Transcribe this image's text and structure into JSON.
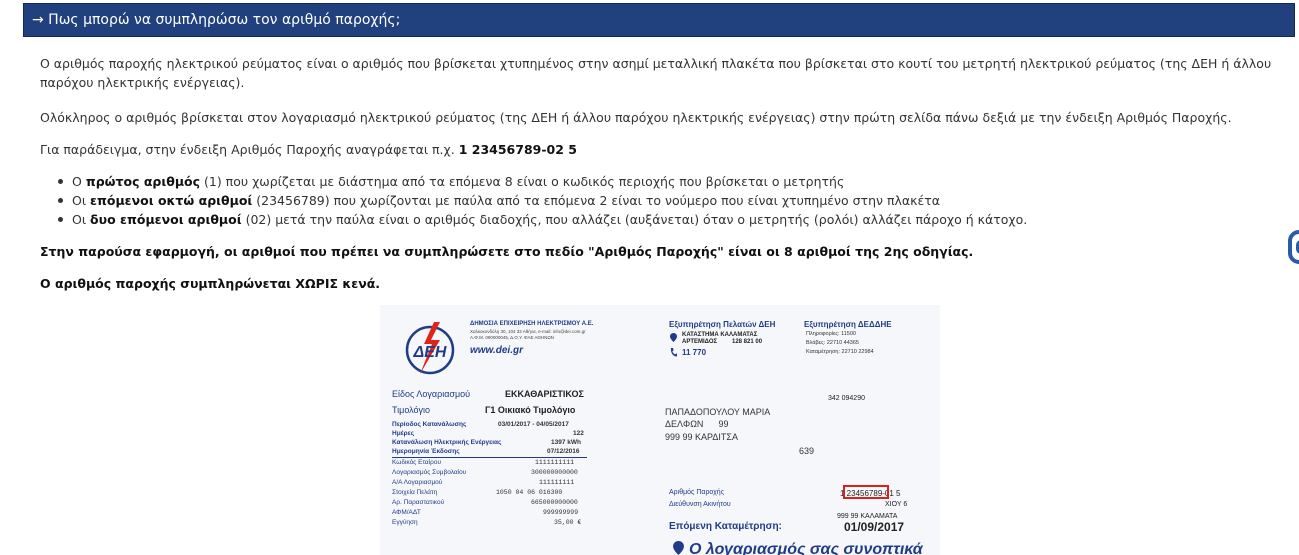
{
  "header": {
    "title": "→ Πως μπορώ να συμπληρώσω τον αριθμό παροχής;"
  },
  "paragraphs": {
    "p1": "Ο αριθμός παροχής ηλεκτρικού ρεύματος είναι ο αριθμός που βρίσκεται χτυπημένος στην ασημί μεταλλική πλακέτα που βρίσκεται στο κουτί του μετρητή ηλεκτρικού ρεύματος (της ΔΕΗ ή άλλου παρόχου ηλεκτρικής ενέργειας).",
    "p2": "Ολόκληρος ο αριθμός βρίσκεται στον λογαριασμό ηλεκτρικού ρεύματος (της ΔΕΗ ή άλλου παρόχου ηλεκτρικής ενέργειας) στην πρώτη σελίδα πάνω δεξιά με την ένδειξη Αριθμός Παροχής.",
    "p3_prefix": "Για παράδειγμα, στην ένδειξη Αριθμός Παροχής αναγράφεται π.χ. ",
    "p3_example": "1 23456789-02 5",
    "p4": "Στην παρούσα εφαρμογή, οι αριθμοί που πρέπει να συμπληρώσετε στο πεδίο \"Αριθμός Παροχής\" είναι οι 8 αριθμοί της 2ης οδηγίας.",
    "p5": "Ο αριθμός παροχής συμπληρώνεται ΧΩΡΙΣ κενά."
  },
  "bullets": [
    {
      "pre": "Ο ",
      "bold": "πρώτος αριθμός",
      "post": " (1) που χωρίζεται με διάστημα από τα επόμενα 8 είναι ο κωδικός περιοχής που βρίσκεται ο μετρητής"
    },
    {
      "pre": "Οι ",
      "bold": "επόμενοι οκτώ αριθμοί",
      "post": " (23456789) που χωρίζονται με παύλα από τα επόμενα 2 είναι το νούμερο που είναι χτυπημένο στην πλακέτα"
    },
    {
      "pre": "Οι ",
      "bold": "δυο επόμενοι αριθμοί",
      "post": " (02) μετά την παύλα είναι ο αριθμός διαδοχής, που αλλάζει (αυξάνεται) όταν ο μετρητής (ρολόι) αλλάζει πάροχο ή κάτοχο."
    }
  ],
  "bill": {
    "logo_text": "ΔΕΗ",
    "company_name": "ΔΗΜΟΣΙΑ ΕΠΙΧΕΙΡΗΣΗ ΗΛΕΚΤΡΙΣΜΟΥ Α.Ε.",
    "company_address": "Χαλκοκονδύλη 30, 104 32 Αθήνα, e-mail: info@dei.com.gr",
    "company_afm": "Α.Φ.Μ. 090000045, Δ.Ο.Υ. ΦΑΕ ΑΘΗΝΩΝ",
    "website": "www.dei.gr",
    "service_title": "Εξυπηρέτηση Πελατών ΔΕΗ",
    "store_name": "ΚΑΤΑΣΤΗΜΑ ΚΑΛΑΜΑΤΑΣ",
    "store_street": "ΑΡΤΕΜΙΔΟΣ",
    "store_number": "128 821 00",
    "phone": "11 770",
    "deddie_title": "Εξυπηρέτηση ΔΕΔΔΗΕ",
    "deddie_lines": [
      "Πληροφορίες: 11500",
      "Βλάβες: 22710 44365",
      "Καταμέτρηση: 22710 22984"
    ],
    "account_type_label": "Είδος Λογαριασμού",
    "account_type_value": "ΕΚΚΑΘΑΡΙΣΤΙΚΟΣ",
    "tariff_label": "Τιμολόγιο",
    "tariff_value": "Γ1 Οικιακό Τιμολόγιο",
    "rows": [
      {
        "label": "Περίοδος Κατανάλωσης",
        "value": "03/01/2017 - 04/05/2017"
      },
      {
        "label": "Ημέρες",
        "value": "122"
      },
      {
        "label": "Κατανάλωση Ηλεκτρικής Ενέργειας",
        "value": "1397 kWh"
      },
      {
        "label": "Ημερομηνία Έκδοσης",
        "value": "07/12/2016"
      }
    ],
    "rows2": [
      {
        "label": "Κωδικός Εταίρου",
        "value": "1111111111"
      },
      {
        "label": "Λογαριασμός Συμβολαίου",
        "value": "300000000000"
      },
      {
        "label": "Α/Α Λογαριασμού",
        "value": "111111111"
      },
      {
        "label": "Στοιχεία Πελάτη",
        "value": "1050 04 06 016300"
      },
      {
        "label": "Αρ. Παραστατικού",
        "value": "665000000000"
      },
      {
        "label": "ΑΦΜ/ΑΔΤ",
        "value": "999999999"
      },
      {
        "label": "Εγγύηση",
        "value": "35,00 €"
      }
    ],
    "ref_number": "342 094290",
    "customer_name": "ΠΑΠΑΔΟΠΟΥΛΟΥ ΜΑΡΙΑ",
    "customer_street": "ΔΕΛΦΩΝ      99",
    "customer_city": "999 99 ΚΑΡΔΙΤΣΑ",
    "code_639": "639",
    "supply_label": "Αριθμός Παροχής",
    "supply_value_prefix": "1 ",
    "supply_value_highlight": "23456789",
    "supply_value_suffix": "-01 5",
    "property_label": "Διεύθυνση Ακινήτου",
    "property_line1": "ΧΙΟΥ 6",
    "property_line2": "999 99 ΚΑΛΑΜΑΤΑ",
    "next_reading_label": "Επόμενη Καταμέτρηση:",
    "next_reading_value": "01/09/2017",
    "summary_title": "Ο λογαριασμός σας συνοπτικά"
  },
  "colors": {
    "header_bg": "#20407e",
    "accent": "#1f3c88",
    "highlight": "#e01e1e"
  }
}
